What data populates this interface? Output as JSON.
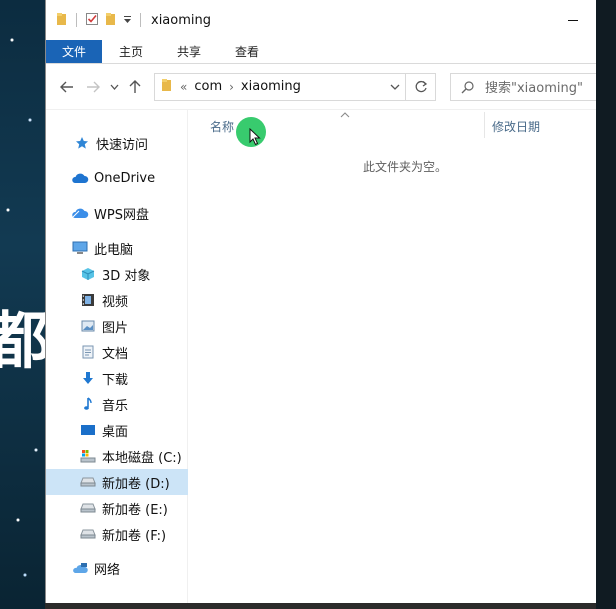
{
  "background": {
    "overlay_text": "都"
  },
  "window": {
    "title": "xiaoming",
    "quick_access": [
      "folder-icon",
      "properties-check-icon",
      "new-folder-icon",
      "customize-dropdown-icon"
    ]
  },
  "ribbon": {
    "tabs": [
      {
        "label": "文件",
        "active": true
      },
      {
        "label": "主页"
      },
      {
        "label": "共享"
      },
      {
        "label": "查看"
      }
    ]
  },
  "address": {
    "overflow": "«",
    "crumbs": [
      "com",
      "xiaoming"
    ]
  },
  "search": {
    "placeholder": "搜索\"xiaoming\""
  },
  "nav": {
    "items": [
      {
        "label": "快速访问",
        "icon": "star-icon"
      },
      {
        "label": "OneDrive",
        "icon": "cloud-icon"
      },
      {
        "label": "WPS网盘",
        "icon": "wps-cloud-icon"
      },
      {
        "label": "此电脑",
        "icon": "computer-icon"
      },
      {
        "label": "3D 对象",
        "icon": "cube-3d-icon"
      },
      {
        "label": "视频",
        "icon": "film-icon"
      },
      {
        "label": "图片",
        "icon": "picture-icon"
      },
      {
        "label": "文档",
        "icon": "document-icon"
      },
      {
        "label": "下载",
        "icon": "download-arrow-icon"
      },
      {
        "label": "音乐",
        "icon": "music-note-icon"
      },
      {
        "label": "桌面",
        "icon": "desktop-icon"
      },
      {
        "label": "本地磁盘 (C:)",
        "icon": "system-drive-icon"
      },
      {
        "label": "新加卷 (D:)",
        "icon": "drive-icon",
        "selected": true
      },
      {
        "label": "新加卷 (E:)",
        "icon": "drive-icon"
      },
      {
        "label": "新加卷 (F:)",
        "icon": "drive-icon"
      },
      {
        "label": "网络",
        "icon": "network-icon"
      }
    ]
  },
  "content": {
    "columns": {
      "name": "名称",
      "date": "修改日期"
    },
    "empty_message": "此文件夹为空。"
  },
  "colors": {
    "accent": "#1a64b6",
    "selected": "#cce4f7",
    "highlight": "#22c55e"
  }
}
